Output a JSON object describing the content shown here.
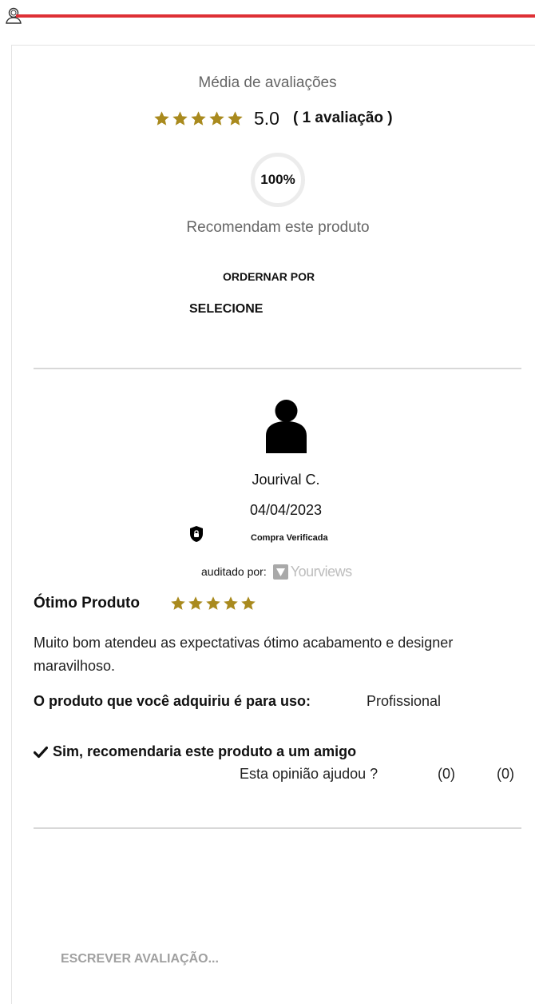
{
  "colors": {
    "accent_red": "#de3035",
    "star_gold": "#a98a1e",
    "muted_text": "#666666"
  },
  "summary": {
    "title": "Média de avaliações",
    "average_score": "5.0",
    "stars_filled": 5,
    "stars_total": 5,
    "count_label": "( 1 avaliação )",
    "recommend_percent": "100%",
    "recommend_label": "Recomendam este produto"
  },
  "sort": {
    "label": "ORDERNAR POR",
    "selected": "SELECIONE"
  },
  "review": {
    "author": "Jourival C.",
    "date": "04/04/2023",
    "verified_label": "Compra Verificada",
    "audited_label": "auditado por:",
    "audit_brand": "Yourviews",
    "title": "Ótimo Produto",
    "stars_filled": 5,
    "body": "Muito bom atendeu as expectativas ótimo acabamento e designer maravilhoso.",
    "use_question": "O produto que você adquiriu é para uso:",
    "use_answer": "Profissional",
    "recommend_text": "Sim, recomendaria este produto a um amigo",
    "helpful_question": "Esta opinião ajudou ?",
    "helpful_yes": "(0)",
    "helpful_no": "(0)"
  },
  "actions": {
    "write_review": "ESCREVER AVALIAÇÃO..."
  },
  "icons": {
    "top_user": "user-outline-icon",
    "star": "star-icon",
    "avatar": "user-silhouette-icon",
    "verified": "shield-lock-icon",
    "check": "check-icon",
    "brand": "yourviews-logo-icon"
  }
}
